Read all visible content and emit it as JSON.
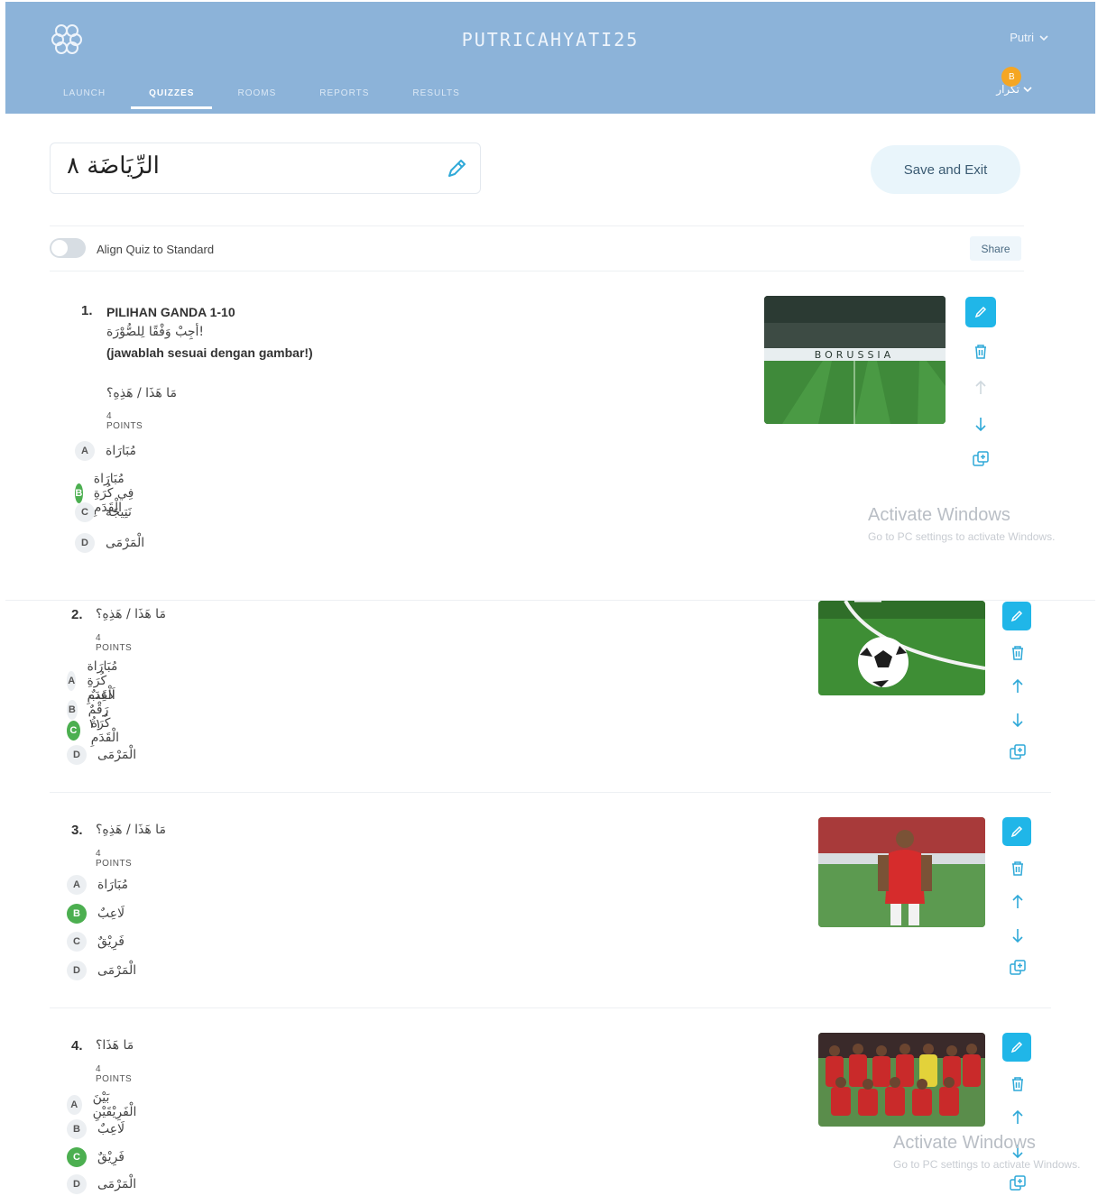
{
  "header": {
    "app_title": "PUTRICAHYATI25",
    "user_name": "Putri",
    "lang_badge": "B",
    "lang_label": "تكرار",
    "colors": {
      "background": "#8cb3d9",
      "accent": "#20b6e8",
      "correct": "#4caf50"
    }
  },
  "tabs": [
    {
      "label": "LAUNCH",
      "active": false
    },
    {
      "label": "QUIZZES",
      "active": true
    },
    {
      "label": "ROOMS",
      "active": false
    },
    {
      "label": "REPORTS",
      "active": false
    },
    {
      "label": "RESULTS",
      "active": false
    }
  ],
  "quiz": {
    "title": "الرِّيَاضَة ٨",
    "save_label": "Save and Exit",
    "align_label": "Align Quiz to Standard",
    "share_label": "Share"
  },
  "questions": [
    {
      "number": "1.",
      "lines": [
        "PILIHAN GANDA 1-10",
        "أجِبْ وَفْقًا لِلصُّوْرَة!",
        "(jawablah sesuai dengan gambar!)"
      ],
      "prompt": "مَا هَذَا / هَذِهِ؟",
      "points": "4 POINTS",
      "options": [
        {
          "letter": "A",
          "text": "مُبَارَاة",
          "correct": false
        },
        {
          "letter": "B",
          "text": "مُبَارَاة فِي كُرَةِ الْقَدَمِ",
          "correct": true
        },
        {
          "letter": "C",
          "text": "نَتِيجَة",
          "correct": false
        },
        {
          "letter": "D",
          "text": "الْمَرْمَى",
          "correct": false
        }
      ],
      "image": "stadium"
    },
    {
      "number": "2.",
      "lines": [],
      "prompt": "مَا هَذَا / هَذِهِ؟",
      "points": "4 POINTS",
      "options": [
        {
          "letter": "A",
          "text": "مُبَارَاة كُرَةِ الْقَدَمِ",
          "correct": false
        },
        {
          "letter": "B",
          "text": "لَاعِبٌ رَقْمٌ ١١",
          "correct": false
        },
        {
          "letter": "C",
          "text": "كُرَةُ الْقَدَمِ",
          "correct": true
        },
        {
          "letter": "D",
          "text": "الْمَرْمَى",
          "correct": false
        }
      ],
      "image": "ball"
    },
    {
      "number": "3.",
      "lines": [],
      "prompt": "مَا هَذَا / هَذِهِ؟",
      "points": "4 POINTS",
      "options": [
        {
          "letter": "A",
          "text": "مُبَارَاة",
          "correct": false
        },
        {
          "letter": "B",
          "text": "لَاعِبٌ",
          "correct": true
        },
        {
          "letter": "C",
          "text": "فَرِيْقٌ",
          "correct": false
        },
        {
          "letter": "D",
          "text": "الْمَرْمَى",
          "correct": false
        }
      ],
      "image": "player"
    },
    {
      "number": "4.",
      "lines": [],
      "prompt": "مَا هَذَا؟",
      "points": "4 POINTS",
      "options": [
        {
          "letter": "A",
          "text": "بَيْنَ الْفَرِيْقَيْنِ",
          "correct": false
        },
        {
          "letter": "B",
          "text": "لَاعِبٌ",
          "correct": false
        },
        {
          "letter": "C",
          "text": "فَرِيْقٌ",
          "correct": true
        },
        {
          "letter": "D",
          "text": "الْمَرْمَى",
          "correct": false
        }
      ],
      "image": "team"
    }
  ],
  "watermarks": [
    {
      "title": "Activate Windows",
      "subtitle": "Go to PC settings to activate Windows."
    },
    {
      "title": "Activate Windows",
      "subtitle": "Go to PC settings to activate Windows."
    }
  ]
}
